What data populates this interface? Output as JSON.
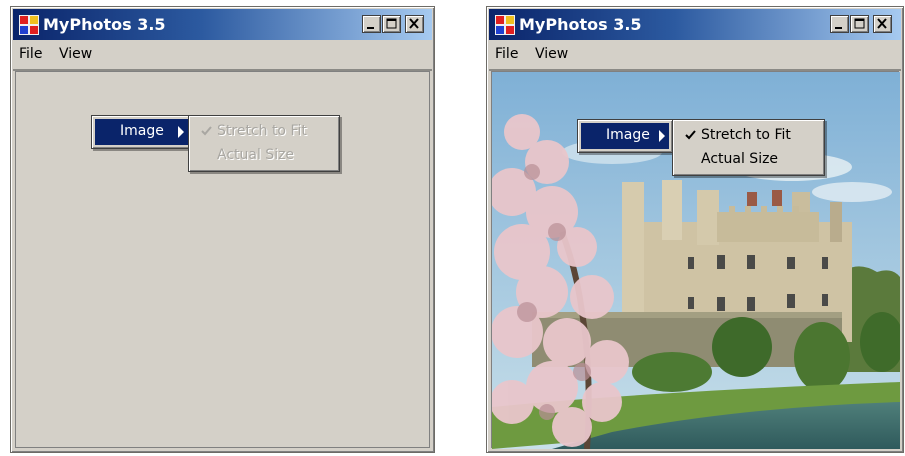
{
  "colors": {
    "titlebar_start": "#0a246a",
    "titlebar_end": "#a6caf0",
    "window_face": "#d4d0c8",
    "menu_highlight": "#0a246a",
    "disabled_text": "#a9a7a2"
  },
  "windows": [
    {
      "title": "MyPhotos 3.5",
      "menu": {
        "file": "File",
        "view": "View"
      },
      "client": "empty",
      "context_menu": {
        "parent_item": "Image",
        "submenu_enabled": false,
        "submenu": [
          {
            "label": "Stretch to Fit",
            "checked": true
          },
          {
            "label": "Actual Size",
            "checked": false
          }
        ]
      }
    },
    {
      "title": "MyPhotos 3.5",
      "menu": {
        "file": "File",
        "view": "View"
      },
      "client": "photo of castle with blossoming tree and moat",
      "context_menu": {
        "parent_item": "Image",
        "submenu_enabled": true,
        "submenu": [
          {
            "label": "Stretch to Fit",
            "checked": true
          },
          {
            "label": "Actual Size",
            "checked": false
          }
        ]
      }
    }
  ],
  "icons": {
    "app": "myphotos-app-icon",
    "minimize": "minimize-icon",
    "maximize": "maximize-icon",
    "close": "close-icon",
    "submenu_arrow": "submenu-arrow-icon",
    "checkmark": "checkmark-icon"
  }
}
